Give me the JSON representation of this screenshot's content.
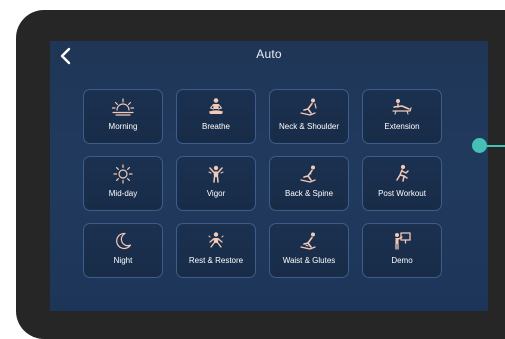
{
  "header": {
    "title": "Auto"
  },
  "colors": {
    "accent": "#46c0b4",
    "icon": "#f2c9b6",
    "screen": "#203a5e",
    "bezel": "#262626"
  },
  "tiles": [
    {
      "label": "Morning",
      "icon": "sunrise-icon"
    },
    {
      "label": "Breathe",
      "icon": "breathe-icon"
    },
    {
      "label": "Neck & Shoulder",
      "icon": "neck-shoulder-icon"
    },
    {
      "label": "Extension",
      "icon": "extension-icon"
    },
    {
      "label": "Mid-day",
      "icon": "sun-icon"
    },
    {
      "label": "Vigor",
      "icon": "vigor-icon"
    },
    {
      "label": "Back & Spine",
      "icon": "back-spine-icon"
    },
    {
      "label": "Post Workout",
      "icon": "post-workout-icon"
    },
    {
      "label": "Night",
      "icon": "moon-icon"
    },
    {
      "label": "Rest & Restore",
      "icon": "rest-restore-icon"
    },
    {
      "label": "Waist & Glutes",
      "icon": "waist-glutes-icon"
    },
    {
      "label": "Demo",
      "icon": "demo-icon"
    }
  ]
}
